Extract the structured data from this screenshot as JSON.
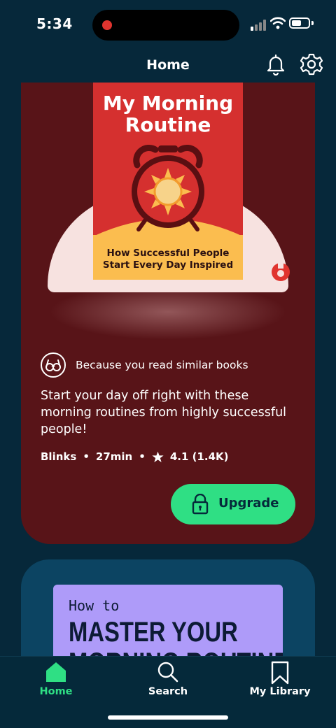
{
  "status_bar": {
    "time": "5:34"
  },
  "header": {
    "title": "Home"
  },
  "card1": {
    "cover": {
      "title": "My Morning Routine",
      "subtitle": "How Successful People Start Every Day Inspired"
    },
    "reason": "Because you read similar books",
    "description": "Start your day off right with these morning routines from highly successful people!",
    "meta": {
      "format": "Blinks",
      "duration": "27min",
      "rating": "4.1 (1.4K)"
    },
    "upgrade_label": "Upgrade",
    "colors": {
      "card_bg": "#581418",
      "cover_red": "#d5302f",
      "cover_yellow": "#fbbd4f",
      "accent_green": "#2fdf84"
    }
  },
  "card2": {
    "cover": {
      "top_text": "How to",
      "main_text": "MASTER YOUR",
      "main_text_2": "MORNING ROUTINE"
    }
  },
  "nav": {
    "items": [
      {
        "label": "Home",
        "icon": "home-icon",
        "active": true
      },
      {
        "label": "Search",
        "icon": "search-icon",
        "active": false
      },
      {
        "label": "My Library",
        "icon": "bookmark-icon",
        "active": false
      }
    ]
  }
}
